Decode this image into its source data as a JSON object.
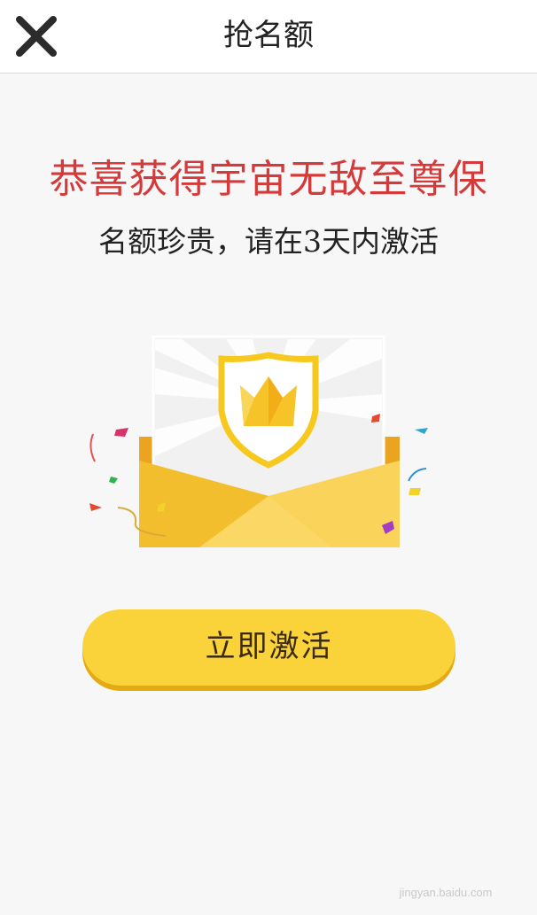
{
  "header": {
    "close_icon": "close-icon",
    "title": "抢名额"
  },
  "main": {
    "headline": "恭喜获得宇宙无敌至尊保",
    "subline": "名额珍贵，请在3天内激活",
    "illustration": "envelope-shield-crown",
    "activate_label": "立即激活"
  },
  "colors": {
    "headline": "#d43a3a",
    "button": "#fad33a",
    "button_shadow": "#e3aa14",
    "envelope": "#f6c940"
  },
  "watermark": {
    "text": "jingyan.baidu.com"
  }
}
